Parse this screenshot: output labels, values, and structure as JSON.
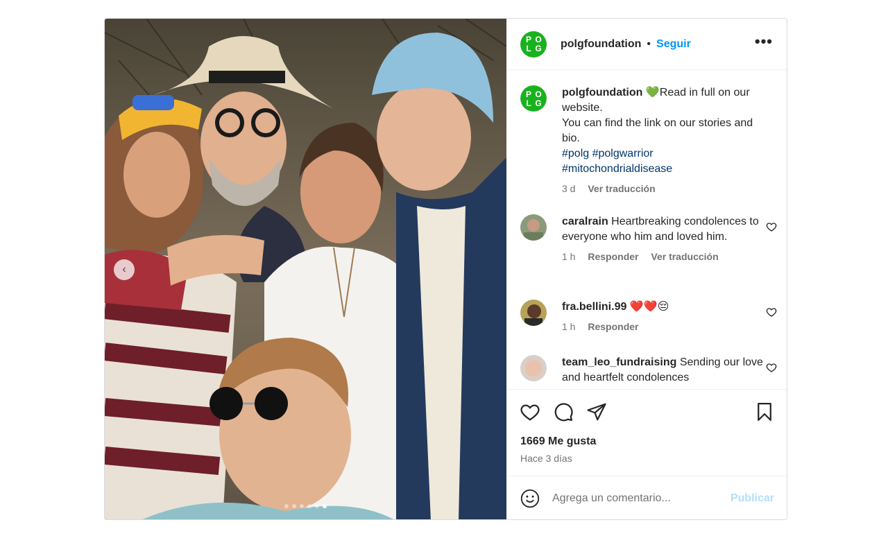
{
  "account": {
    "username": "polgfoundation",
    "separator": "•",
    "follow_label": "Seguir",
    "more_label": "•••",
    "logo_letters": [
      "P",
      "O",
      "L",
      "G"
    ],
    "brand_color": "#19b21e"
  },
  "caption": {
    "username": "polgfoundation",
    "emoji": "💚",
    "line1": "Read in full on our website.",
    "line2": "You can find the link on our stories and bio.",
    "hashtags_line1": "#polg #polgwarrior",
    "hashtags_line2": "#mitochondrialdisease",
    "time": "3 d",
    "translate_label": "Ver traducción"
  },
  "comments": [
    {
      "username": "caralrain",
      "text": "Heartbreaking condolences to everyone who him and loved him.",
      "time": "1 h",
      "reply_label": "Responder",
      "translate_label": "Ver traducción"
    },
    {
      "username": "fra.bellini.99",
      "text": "❤️❤️😔",
      "time": "1 h",
      "reply_label": "Responder"
    },
    {
      "username": "team_leo_fundraising",
      "text": "Sending our love and heartfelt condolences"
    }
  ],
  "stats": {
    "likes": "1669 Me gusta",
    "date": "Hace 3 días"
  },
  "composer": {
    "placeholder": "Agrega un comentario...",
    "publish_label": "Publicar"
  },
  "carousel": {
    "prev_label": "‹",
    "total_slides": 6,
    "active_slide": 6
  },
  "colors": {
    "link": "#0095f6",
    "hashtag": "#00376b",
    "muted": "#737373",
    "publish_disabled": "#b2dffc"
  }
}
